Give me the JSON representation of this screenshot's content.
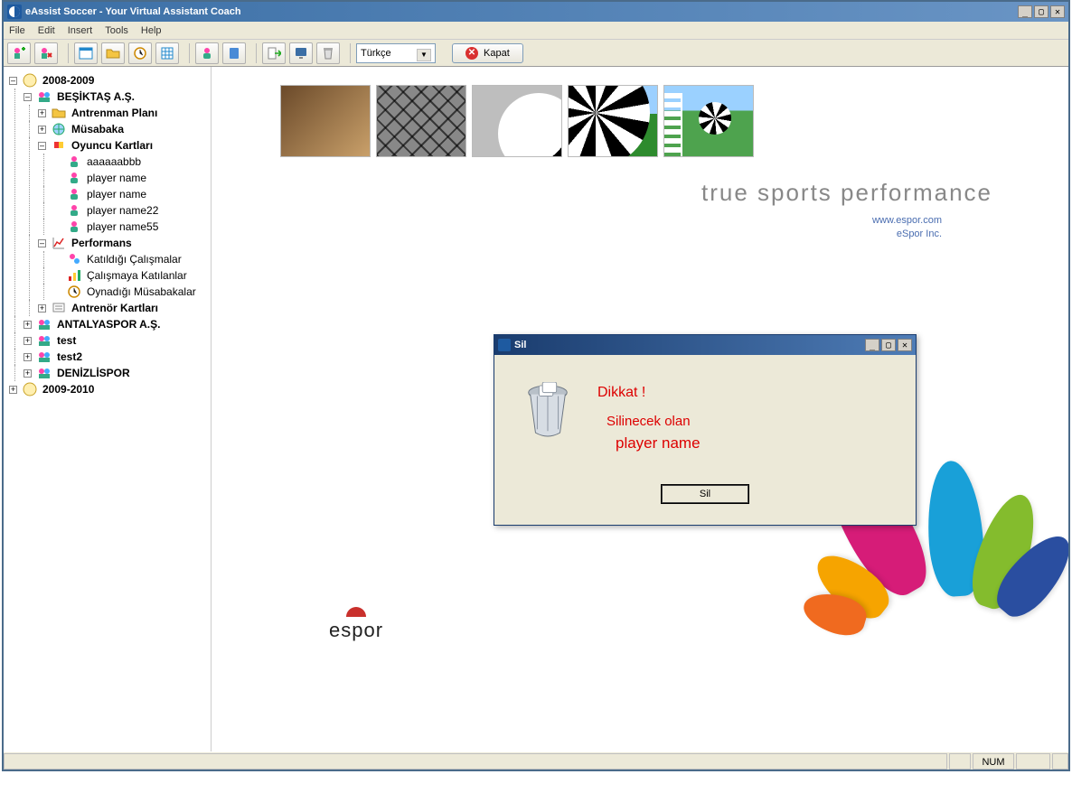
{
  "window": {
    "title": "eAssist Soccer - Your Virtual Assistant Coach"
  },
  "menu": {
    "file": "File",
    "edit": "Edit",
    "insert": "Insert",
    "tools": "Tools",
    "help": "Help"
  },
  "toolbar": {
    "language_selected": "Türkçe",
    "close_label": "Kapat"
  },
  "tree": {
    "root1": "2008-2009",
    "team1": "BEŞİKTAŞ A.Ş.",
    "team1_items": {
      "antrenman": "Antrenman Planı",
      "musabaka": "Müsabaka",
      "oyuncu": "Oyuncu Kartları",
      "players": [
        "aaaaaabbb",
        "player name",
        "player name",
        "player name22",
        "player name55"
      ],
      "performans": "Performans",
      "perf_items": [
        "Katıldığı Çalışmalar",
        "Çalışmaya Katılanlar",
        "Oynadığı Müsabakalar"
      ],
      "antrenor": "Antrenör Kartları"
    },
    "team2": "ANTALYASPOR A.Ş.",
    "team3": "test",
    "team4": "test2",
    "team5": "DENİZLİSPOR",
    "root2": "2009-2010"
  },
  "main": {
    "tagline": "true sports performance",
    "link1": "www.espor.com",
    "link2": "eSpor Inc.",
    "brand": "espor"
  },
  "dialog": {
    "title": "Sil",
    "heading": "Dikkat !",
    "line1": "Silinecek olan",
    "entity": "player name",
    "button": "Sil"
  },
  "status": {
    "num": "NUM"
  }
}
